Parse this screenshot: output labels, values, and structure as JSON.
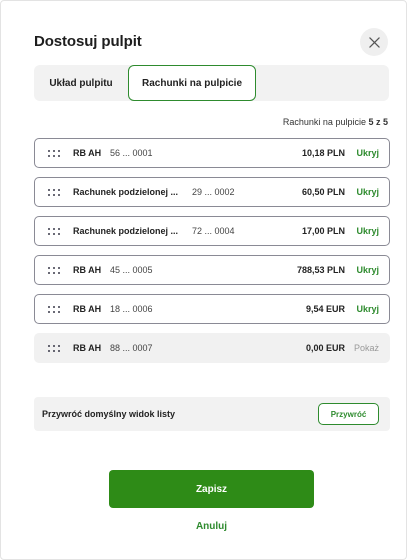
{
  "modal": {
    "title": "Dostosuj pulpit"
  },
  "tabs": [
    {
      "label": "Układ pulpitu"
    },
    {
      "label": "Rachunki na pulpicie"
    }
  ],
  "count": {
    "label": "Rachunki na pulpicie",
    "value": "5 z 5"
  },
  "accounts": [
    {
      "name": "RB AH",
      "number": "56 ... 0001",
      "amount": "10,18 PLN",
      "action": "Ukryj"
    },
    {
      "name": "Rachunek podzielonej ...",
      "number": "29 ... 0002",
      "amount": "60,50 PLN",
      "action": "Ukryj"
    },
    {
      "name": "Rachunek podzielonej ...",
      "number": "72 ... 0004",
      "amount": "17,00 PLN",
      "action": "Ukryj"
    },
    {
      "name": "RB AH",
      "number": "45 ... 0005",
      "amount": "788,53 PLN",
      "action": "Ukryj"
    },
    {
      "name": "RB AH",
      "number": "18 ... 0006",
      "amount": "9,54 EUR",
      "action": "Ukryj"
    },
    {
      "name": "RB AH",
      "number": "88 ... 0007",
      "amount": "0,00 EUR",
      "action": "Pokaż"
    }
  ],
  "restore": {
    "label": "Przywróć domyślny widok listy",
    "button": "Przywróć"
  },
  "footer": {
    "save": "Zapisz",
    "cancel": "Anuluj"
  },
  "colors": {
    "accent": "#2e8b2e",
    "primary_button": "#2e8b17"
  }
}
